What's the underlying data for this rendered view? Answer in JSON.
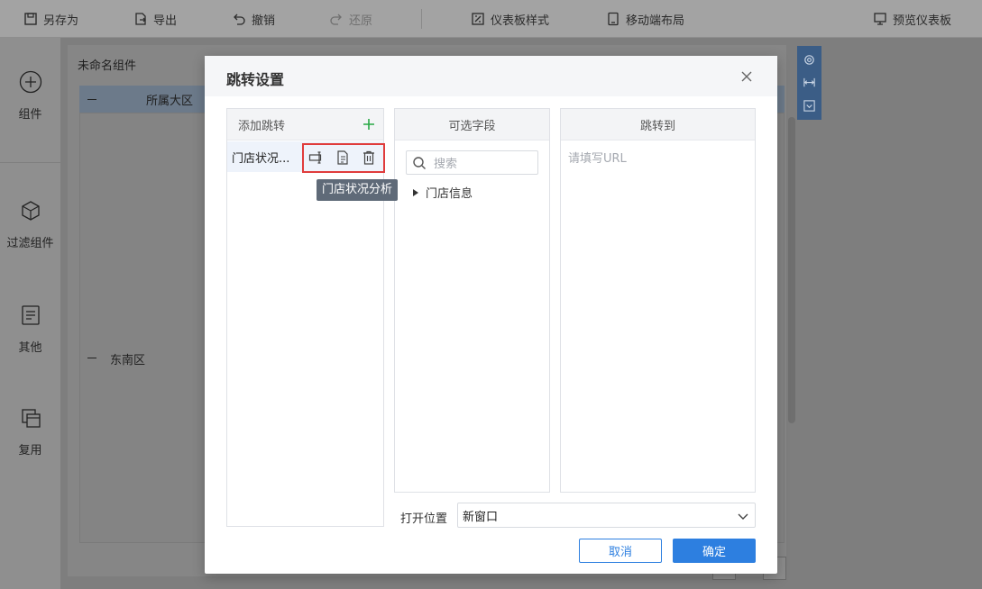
{
  "toolbar": {
    "save_as": "另存为",
    "export": "导出",
    "undo": "撤销",
    "redo": "还原",
    "dashboard_style": "仪表板样式",
    "mobile_layout": "移动端布局",
    "preview": "预览仪表板"
  },
  "sidebar": {
    "items": [
      {
        "label": "组件",
        "icon": "plus-circle-icon"
      },
      {
        "label": "过滤组件",
        "icon": "cube-icon"
      },
      {
        "label": "其他",
        "icon": "document-icon"
      },
      {
        "label": "复用",
        "icon": "copy-icon"
      }
    ]
  },
  "canvas": {
    "widget_title": "未命名组件",
    "header_col": "所属大区",
    "row_label": "东南区"
  },
  "dialog": {
    "title": "跳转设置",
    "left_panel": {
      "header": "添加跳转",
      "item_label": "门店状况...",
      "tooltip": "门店状况分析"
    },
    "middle_panel": {
      "header": "可选字段",
      "search_placeholder": "搜索",
      "tree_node": "门店信息"
    },
    "right_panel": {
      "header": "跳转到",
      "url_placeholder": "请填写URL"
    },
    "open_position": {
      "label": "打开位置",
      "value": "新窗口"
    },
    "cancel": "取消",
    "confirm": "确定"
  },
  "colors": {
    "accent": "#2d7fe0",
    "add_green": "#27a844",
    "highlight_red": "#e03c3c",
    "tooltip_bg": "#5f6a78"
  }
}
